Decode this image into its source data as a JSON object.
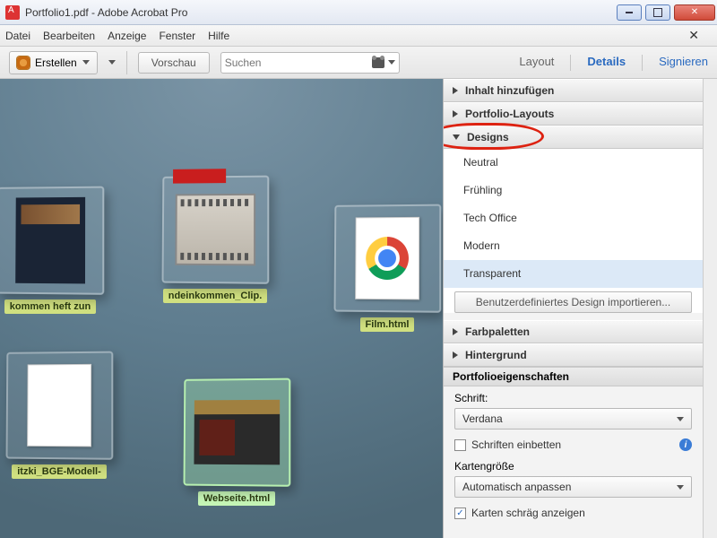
{
  "titlebar": {
    "title": "Portfolio1.pdf - Adobe Acrobat Pro"
  },
  "menubar": {
    "items": [
      "Datei",
      "Bearbeiten",
      "Anzeige",
      "Fenster",
      "Hilfe"
    ]
  },
  "toolbar": {
    "create_label": "Erstellen",
    "preview_label": "Vorschau",
    "search_placeholder": "Suchen",
    "tab_layout": "Layout",
    "tab_details": "Details",
    "tab_sign": "Signieren"
  },
  "files": [
    {
      "label": "kommen heft zun"
    },
    {
      "label": "ndeinkommen_Clip."
    },
    {
      "label": "Film.html"
    },
    {
      "label": "itzki_BGE-Modell-"
    },
    {
      "label": "Webseite.html"
    }
  ],
  "panel": {
    "sections": {
      "add_content": "Inhalt hinzufügen",
      "layouts": "Portfolio-Layouts",
      "designs": "Designs",
      "palettes": "Farbpaletten",
      "background": "Hintergrund"
    },
    "designs": {
      "items": [
        "Neutral",
        "Frühling",
        "Tech Office",
        "Modern",
        "Transparent"
      ],
      "selected": "Transparent",
      "import_label": "Benutzerdefiniertes Design importieren..."
    },
    "props": {
      "header": "Portfolioeigenschaften",
      "font_label": "Schrift:",
      "font_value": "Verdana",
      "embed_fonts": "Schriften einbetten",
      "card_size_label": "Kartengröße",
      "card_size_value": "Automatisch anpassen",
      "tilt_label": "Karten schräg anzeigen"
    }
  }
}
